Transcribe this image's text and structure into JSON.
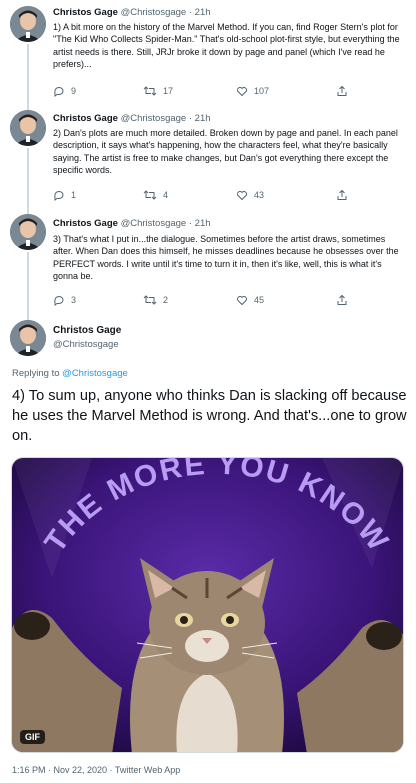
{
  "thread": [
    {
      "author": "Christos Gage",
      "handle": "@Christosgage",
      "time": "21h",
      "body": "1) A bit more on the history of the Marvel Method. If you can, find Roger Stern's plot for \"The Kid Who Collects Spider-Man.\" That's old-school plot-first style, but everything the artist needs is there. Still, JRJr broke it down by page and panel (which I've read he prefers)...",
      "replies": "9",
      "retweets": "17",
      "likes": "107"
    },
    {
      "author": "Christos Gage",
      "handle": "@Christosgage",
      "time": "21h",
      "body": "2) Dan's plots are much more detailed. Broken down by page and panel. In each panel description, it says what's happening, how the characters feel, what they're basically saying. The artist is free to make changes, but Dan's got everything there except the specific words.",
      "replies": "1",
      "retweets": "4",
      "likes": "43"
    },
    {
      "author": "Christos Gage",
      "handle": "@Christosgage",
      "time": "21h",
      "body": "3) That's what I put in...the dialogue. Sometimes before the artist draws, sometimes after. When Dan does this himself, he misses deadlines because he obsesses over the PERFECT words. I write until it's time to turn it in, then it's like, well, this is what it's gonna be.",
      "replies": "3",
      "retweets": "2",
      "likes": "45"
    }
  ],
  "main_tweet": {
    "author": "Christos Gage",
    "handle": "@Christosgage",
    "replying_prefix": "Replying to",
    "replying_to": "@Christosgage",
    "body": "4) To sum up, anyone who thinks Dan is slacking off because he uses the Marvel Method is wrong. And that's...one to grow on.",
    "media_caption": "THE MORE YOU KNOW",
    "gif_badge": "GIF",
    "footer": "1:16 PM · Nov 22, 2020 · Twitter Web App"
  },
  "colors": {
    "link": "#1d9bf0",
    "secondary_text": "#536471",
    "thread_line": "#cfd9de",
    "media_bg": "#3a1478",
    "media_text": "#b79cf2"
  },
  "icons": [
    "reply-icon",
    "retweet-icon",
    "like-icon",
    "share-icon"
  ]
}
